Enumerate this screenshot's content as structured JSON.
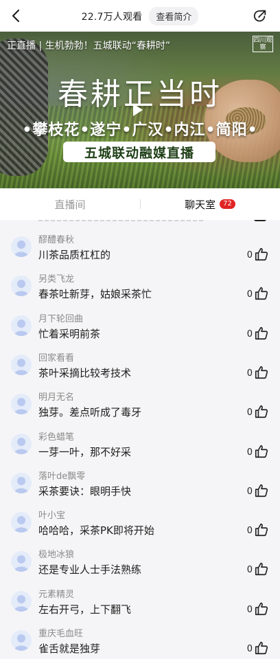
{
  "header": {
    "viewers": "22.7万人观看",
    "intro_button": "查看简介"
  },
  "video": {
    "title": "正直播 | 生机勃勃！五城联动“春耕时”",
    "brand": "四川观察",
    "headline": "春耕正当时",
    "cities": "•攀枝花•遂宁•广汉•内江•简阳•",
    "subtitle": "五城联动融媒直播"
  },
  "tabs": {
    "live": "直播间",
    "chat": "聊天室",
    "chat_count": "72"
  },
  "messages": [
    {
      "name": "醪醴春秋",
      "text": "川茶品质杠杠的",
      "likes": "0"
    },
    {
      "name": "另类飞龙",
      "text": "春茶吐新芽，姑娘采茶忙",
      "likes": "0"
    },
    {
      "name": "月下轮回曲",
      "text": "忙着采明前茶",
      "likes": "0"
    },
    {
      "name": "回家看看",
      "text": "茶叶采摘比较考技术",
      "likes": "0"
    },
    {
      "name": "明月无名",
      "text": "独芽。差点听成了毒牙",
      "likes": "0"
    },
    {
      "name": "彩色蜡笔",
      "text": "一芽一叶，那不好采",
      "likes": "0"
    },
    {
      "name": "落叶de飘零",
      "text": "采茶要诀：眼明手快",
      "likes": "0"
    },
    {
      "name": "叶小宝",
      "text": "哈哈哈，采茶PK即将开始",
      "likes": "0"
    },
    {
      "name": "极地冰狼",
      "text": "还是专业人士手法熟练",
      "likes": "0"
    },
    {
      "name": "元素精灵",
      "text": "左右开弓，上下翻飞",
      "likes": "0"
    },
    {
      "name": "重庆毛血旺",
      "text": "雀舌就是独芽",
      "likes": "0"
    }
  ],
  "colors": {
    "badge": "#e02424",
    "avatar_bg": "#e4ebf9",
    "avatar_fg": "#b9c9ef"
  }
}
